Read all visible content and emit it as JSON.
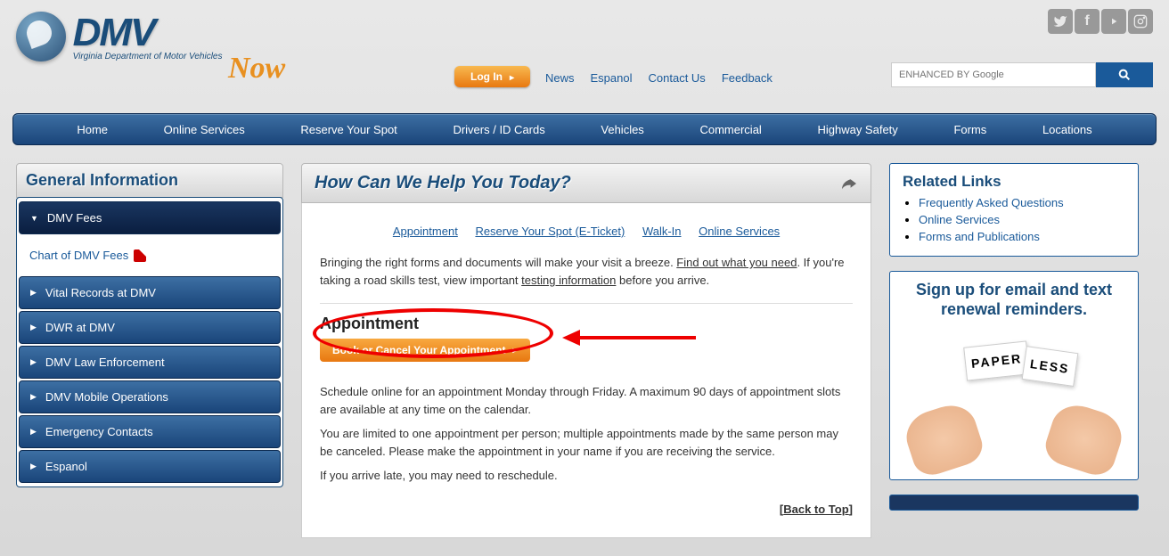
{
  "header": {
    "logo_main": "DMV",
    "logo_tagline": "Virginia Department of Motor Vehicles",
    "logo_accent": "Now",
    "login_label": "Log In",
    "top_links": [
      "News",
      "Espanol",
      "Contact Us",
      "Feedback"
    ],
    "search_placeholder": "ENHANCED BY Google",
    "social_names": [
      "twitter",
      "facebook",
      "youtube",
      "instagram"
    ]
  },
  "nav": [
    "Home",
    "Online Services",
    "Reserve Your Spot",
    "Drivers / ID Cards",
    "Vehicles",
    "Commercial",
    "Highway Safety",
    "Forms",
    "Locations"
  ],
  "sidebar": {
    "title": "General Information",
    "active_item": "DMV Fees",
    "sub_item": "Chart of DMV Fees",
    "items": [
      "Vital Records at DMV",
      "DWR at DMV",
      "DMV Law Enforcement",
      "DMV Mobile Operations",
      "Emergency Contacts",
      "Espanol"
    ]
  },
  "main": {
    "title": "How Can We Help You Today?",
    "tabs": [
      "Appointment",
      "Reserve Your Spot (E-Ticket)",
      "Walk-In",
      "Online Services"
    ],
    "intro_1": "Bringing the right forms and documents will make your visit a breeze. ",
    "intro_link1": "Find out what you need",
    "intro_2": ". If you're taking a road skills test, view important ",
    "intro_link2": "testing information",
    "intro_3": " before you arrive.",
    "section_heading": "Appointment",
    "action_label": "Book or Cancel Your Appointment",
    "para1": "Schedule online for an appointment Monday through Friday. A maximum 90 days of appointment slots are available at any time on the calendar.",
    "para2": "You are limited to one appointment per person; multiple appointments made by the same person may be canceled. Please make the appointment in your name if you are receiving the service.",
    "para3": "If you arrive late, you may need to reschedule.",
    "back_to_top": "Back to Top"
  },
  "related": {
    "title": "Related Links",
    "links": [
      "Frequently Asked Questions",
      "Online Services",
      "Forms and Publications"
    ]
  },
  "promo": {
    "title_line1": "Sign up for email and text",
    "title_line2": "renewal reminders.",
    "paper_left": "PAPER",
    "paper_right": "LESS"
  }
}
